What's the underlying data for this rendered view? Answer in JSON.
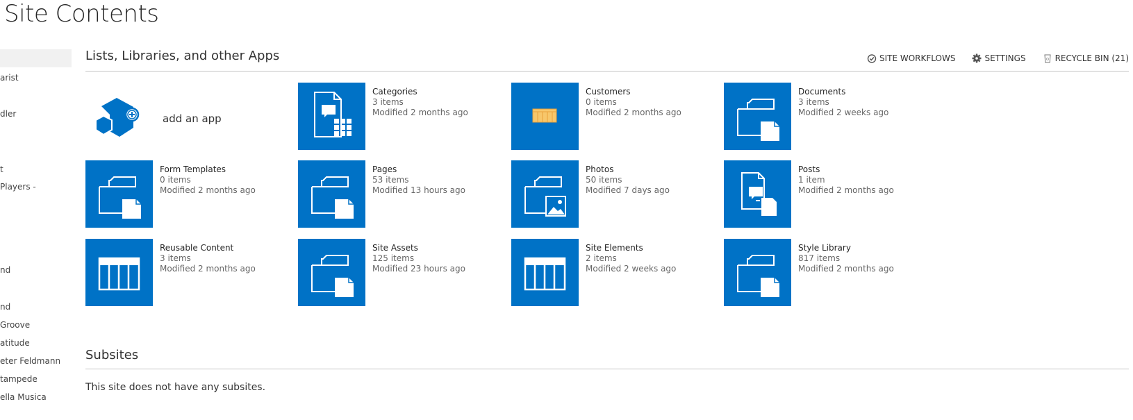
{
  "page": {
    "title": "Site Contents"
  },
  "leftnav": {
    "items": [
      "arist",
      "dler",
      "t",
      "Players -",
      "nd",
      "nd",
      "Groove",
      "atitude",
      "eter Feldmann",
      "tampede",
      "ella Musica"
    ]
  },
  "lists": {
    "heading": "Lists, Libraries, and other Apps",
    "actions": [
      {
        "label": "SITE WORKFLOWS",
        "icon": "workflow-check-icon"
      },
      {
        "label": "SETTINGS",
        "icon": "gear-icon"
      },
      {
        "label": "RECYCLE BIN (21)",
        "icon": "recycle-bin-icon"
      }
    ],
    "add_app": "add an app",
    "tiles": [
      {
        "name": "Categories",
        "count": "3 items",
        "modified": "Modified 2 months ago",
        "icon": "list-doc"
      },
      {
        "name": "Customers",
        "count": "0 items",
        "modified": "Modified 2 months ago",
        "icon": "custom-list"
      },
      {
        "name": "Documents",
        "count": "3 items",
        "modified": "Modified 2 weeks ago",
        "icon": "folder-doc"
      },
      {
        "name": "Form Templates",
        "count": "0 items",
        "modified": "Modified 2 months ago",
        "icon": "folder-doc"
      },
      {
        "name": "Pages",
        "count": "53 items",
        "modified": "Modified 13 hours ago",
        "icon": "folder-doc"
      },
      {
        "name": "Photos",
        "count": "50 items",
        "modified": "Modified 7 days ago",
        "icon": "folder-image"
      },
      {
        "name": "Posts",
        "count": "1 item",
        "modified": "Modified 2 months ago",
        "icon": "posts"
      },
      {
        "name": "Reusable Content",
        "count": "3 items",
        "modified": "Modified 2 months ago",
        "icon": "table"
      },
      {
        "name": "Site Assets",
        "count": "125 items",
        "modified": "Modified 23 hours ago",
        "icon": "folder-doc"
      },
      {
        "name": "Site Elements",
        "count": "2 items",
        "modified": "Modified 2 weeks ago",
        "icon": "table"
      },
      {
        "name": "Style Library",
        "count": "817 items",
        "modified": "Modified 2 months ago",
        "icon": "folder-doc"
      }
    ]
  },
  "subsites": {
    "heading": "Subsites",
    "empty_text": "This site does not have any subsites."
  },
  "colors": {
    "tile": "#0072c6"
  }
}
